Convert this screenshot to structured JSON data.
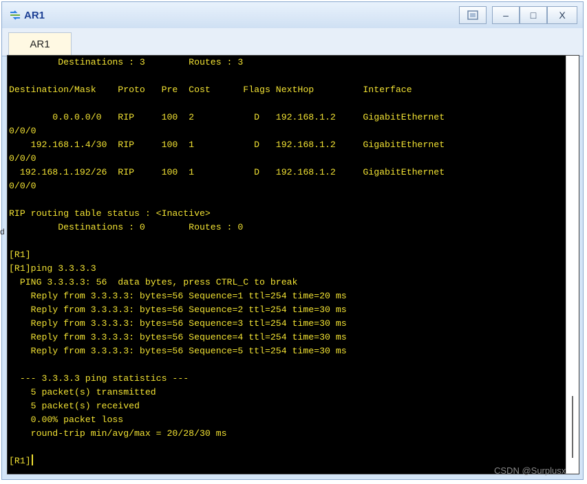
{
  "window": {
    "title": "AR1",
    "tab_label": "AR1",
    "controls": {
      "restore_icon": "restore-window-icon",
      "minimize": "–",
      "maximize": "□",
      "close": "X"
    }
  },
  "terminal": {
    "lines": [
      "         Destinations : 3        Routes : 3",
      "",
      "Destination/Mask    Proto   Pre  Cost      Flags NextHop         Interface",
      "",
      "        0.0.0.0/0   RIP     100  2           D   192.168.1.2     GigabitEthernet",
      "0/0/0",
      "    192.168.1.4/30  RIP     100  1           D   192.168.1.2     GigabitEthernet",
      "0/0/0",
      "  192.168.1.192/26  RIP     100  1           D   192.168.1.2     GigabitEthernet",
      "0/0/0",
      "",
      "RIP routing table status : <Inactive>",
      "         Destinations : 0        Routes : 0",
      "",
      "[R1]",
      "[R1]ping 3.3.3.3",
      "  PING 3.3.3.3: 56  data bytes, press CTRL_C to break",
      "    Reply from 3.3.3.3: bytes=56 Sequence=1 ttl=254 time=20 ms",
      "    Reply from 3.3.3.3: bytes=56 Sequence=2 ttl=254 time=30 ms",
      "    Reply from 3.3.3.3: bytes=56 Sequence=3 ttl=254 time=30 ms",
      "    Reply from 3.3.3.3: bytes=56 Sequence=4 ttl=254 time=30 ms",
      "    Reply from 3.3.3.3: bytes=56 Sequence=5 ttl=254 time=30 ms",
      "",
      "  --- 3.3.3.3 ping statistics ---",
      "    5 packet(s) transmitted",
      "    5 packet(s) received",
      "    0.00% packet loss",
      "    round-trip min/avg/max = 20/28/30 ms",
      "",
      "[R1]"
    ],
    "text_color": "#f2e233",
    "background": "#000000"
  },
  "watermark": "CSDN @Surplusx",
  "edge_fragment": "d"
}
